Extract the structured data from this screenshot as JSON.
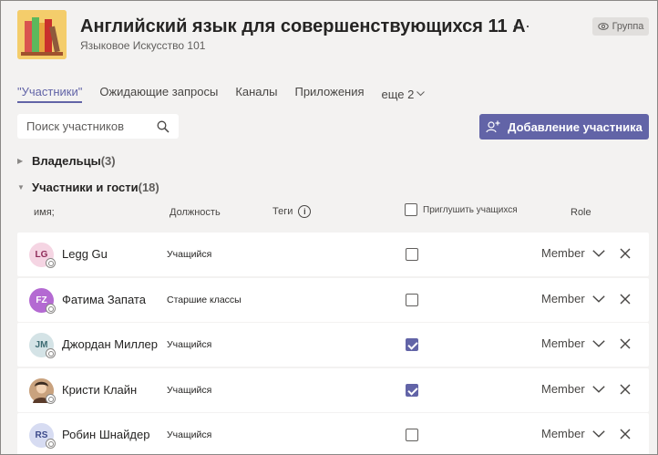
{
  "header": {
    "title": "Английский язык для совершенствующихся 11 А",
    "subtitle": "Языковое Искусство 101",
    "more_label": "···",
    "privacy_label": "Группа"
  },
  "tabs": [
    {
      "label": "\"Участники\"",
      "active": true
    },
    {
      "label": "Ожидающие запросы",
      "active": false
    },
    {
      "label": "Каналы",
      "active": false
    },
    {
      "label": "Приложения",
      "active": false
    }
  ],
  "tabs_more_label": "еще 2",
  "search": {
    "placeholder": "Поиск участников"
  },
  "add_member_label": "Добавление участника",
  "groups": {
    "owners_label": "Владельцы",
    "owners_count": "(3)",
    "members_label": "Участники и гости",
    "members_count": "(18)"
  },
  "columns": {
    "name": "имя;",
    "title": "Должность",
    "tags": "Теги",
    "mute": "Приглушить учащихся",
    "role": "Role"
  },
  "members": [
    {
      "initials": "LG",
      "name": "Legg Gu",
      "role": "Учащийся",
      "muted": false,
      "member_label": "Member",
      "avatar_bg": "#f5d5e3",
      "avatar_fg": "#8e2b58"
    },
    {
      "initials": "FZ",
      "name": "Фатима Запата",
      "role": "Старшие классы",
      "muted": false,
      "member_label": "Member",
      "avatar_bg": "#b46ad2",
      "avatar_fg": "#ffffff"
    },
    {
      "initials": "JM",
      "name": "Джордан Миллер",
      "role": "Учащийся",
      "muted": true,
      "member_label": "Member",
      "avatar_bg": "#d4e3e6",
      "avatar_fg": "#3d6b72"
    },
    {
      "initials": "",
      "name": "Кристи Клайн",
      "role": "Учащийся",
      "muted": true,
      "member_label": "Member",
      "avatar_bg": "#d9c2a6",
      "avatar_fg": "#ffffff"
    },
    {
      "initials": "RS",
      "name": "Робин Шнайдер",
      "role": "Учащийся",
      "muted": false,
      "member_label": "Member",
      "avatar_bg": "#d7dcf2",
      "avatar_fg": "#3c4a8a"
    }
  ],
  "colors": {
    "accent": "#6264a7",
    "logo_bg": "#f4cd6b"
  }
}
